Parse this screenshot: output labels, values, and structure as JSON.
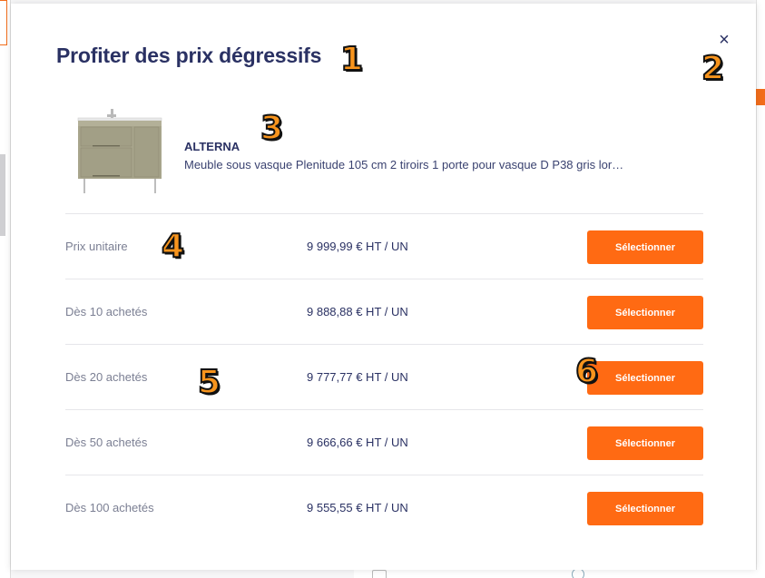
{
  "modal": {
    "title": "Profiter des prix dégressifs",
    "close_glyph": "×"
  },
  "product": {
    "brand": "ALTERNA",
    "description": "Meuble sous vasque Plenitude 105 cm 2 tiroirs 1 porte pour vasque D P38 gris lor…",
    "image_icon": "bathroom-vanity-cabinet"
  },
  "price_rows": [
    {
      "label": "Prix unitaire",
      "price": "9 999,99 € HT / UN",
      "button": "Sélectionner"
    },
    {
      "label": "Dès 10 achetés",
      "price": "9 888,88 € HT / UN",
      "button": "Sélectionner"
    },
    {
      "label": "Dès 20 achetés",
      "price": "9 777,77 € HT / UN",
      "button": "Sélectionner"
    },
    {
      "label": "Dès 50 achetés",
      "price": "9 666,66 € HT / UN",
      "button": "Sélectionner"
    },
    {
      "label": "Dès 100 achetés",
      "price": "9 555,55 € HT / UN",
      "button": "Sélectionner"
    }
  ],
  "annotations": [
    "1",
    "2",
    "3",
    "4",
    "5",
    "6"
  ],
  "colors": {
    "accent": "#ff6a13",
    "title": "#2a3163",
    "marker": "#f7941d"
  }
}
